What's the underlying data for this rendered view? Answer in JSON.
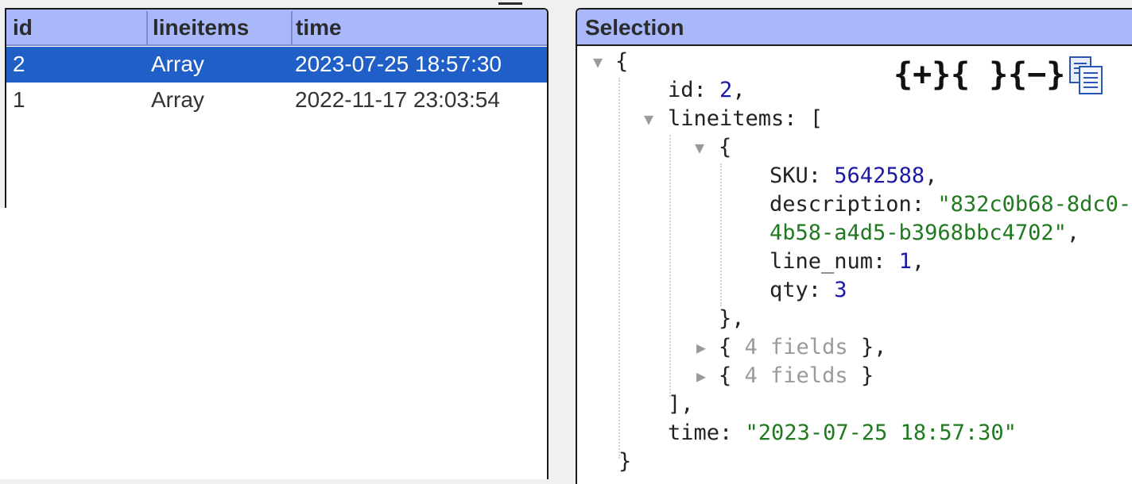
{
  "grid": {
    "columns": [
      "id",
      "lineitems",
      "time"
    ],
    "rows": [
      {
        "id": "2",
        "lineitems": "Array",
        "time": "2023-07-25 18:57:30",
        "selected": true
      },
      {
        "id": "1",
        "lineitems": "Array",
        "time": "2022-11-17 23:03:54",
        "selected": false
      }
    ]
  },
  "selection": {
    "title": "Selection",
    "toolbar": {
      "expand_all": "{+}",
      "braces": "{ }",
      "collapse_all": "{−}",
      "copy_icon": "clipboard-copy-icon"
    },
    "json": {
      "open_brace": "{",
      "id_key": "id:",
      "id_val": "2",
      "lineitems_key": "lineitems:",
      "lineitems_open": "[",
      "item_open": "{",
      "sku_key": "SKU:",
      "sku_val": "5642588",
      "desc_key": "description:",
      "desc_val_1": "\"832c0b68-8dc0-",
      "desc_val_2": "4b58-a4d5-b3968bbc4702\"",
      "line_num_key": "line_num:",
      "line_num_val": "1",
      "qty_key": "qty:",
      "qty_val": "3",
      "item_close": "},",
      "collapsed_1_open": "{",
      "collapsed_1_text": "4 fields",
      "collapsed_1_close": "},",
      "collapsed_2_open": "{",
      "collapsed_2_text": "4 fields",
      "collapsed_2_close": "}",
      "lineitems_close": "],",
      "time_key": "time:",
      "time_val": "\"2023-07-25 18:57:30\"",
      "close_brace": "}"
    }
  },
  "colors": {
    "header_bg": "#a9b8fb",
    "selected_row": "#1f5fc7",
    "number": "#1a1aa6",
    "string": "#1f7a1f"
  }
}
